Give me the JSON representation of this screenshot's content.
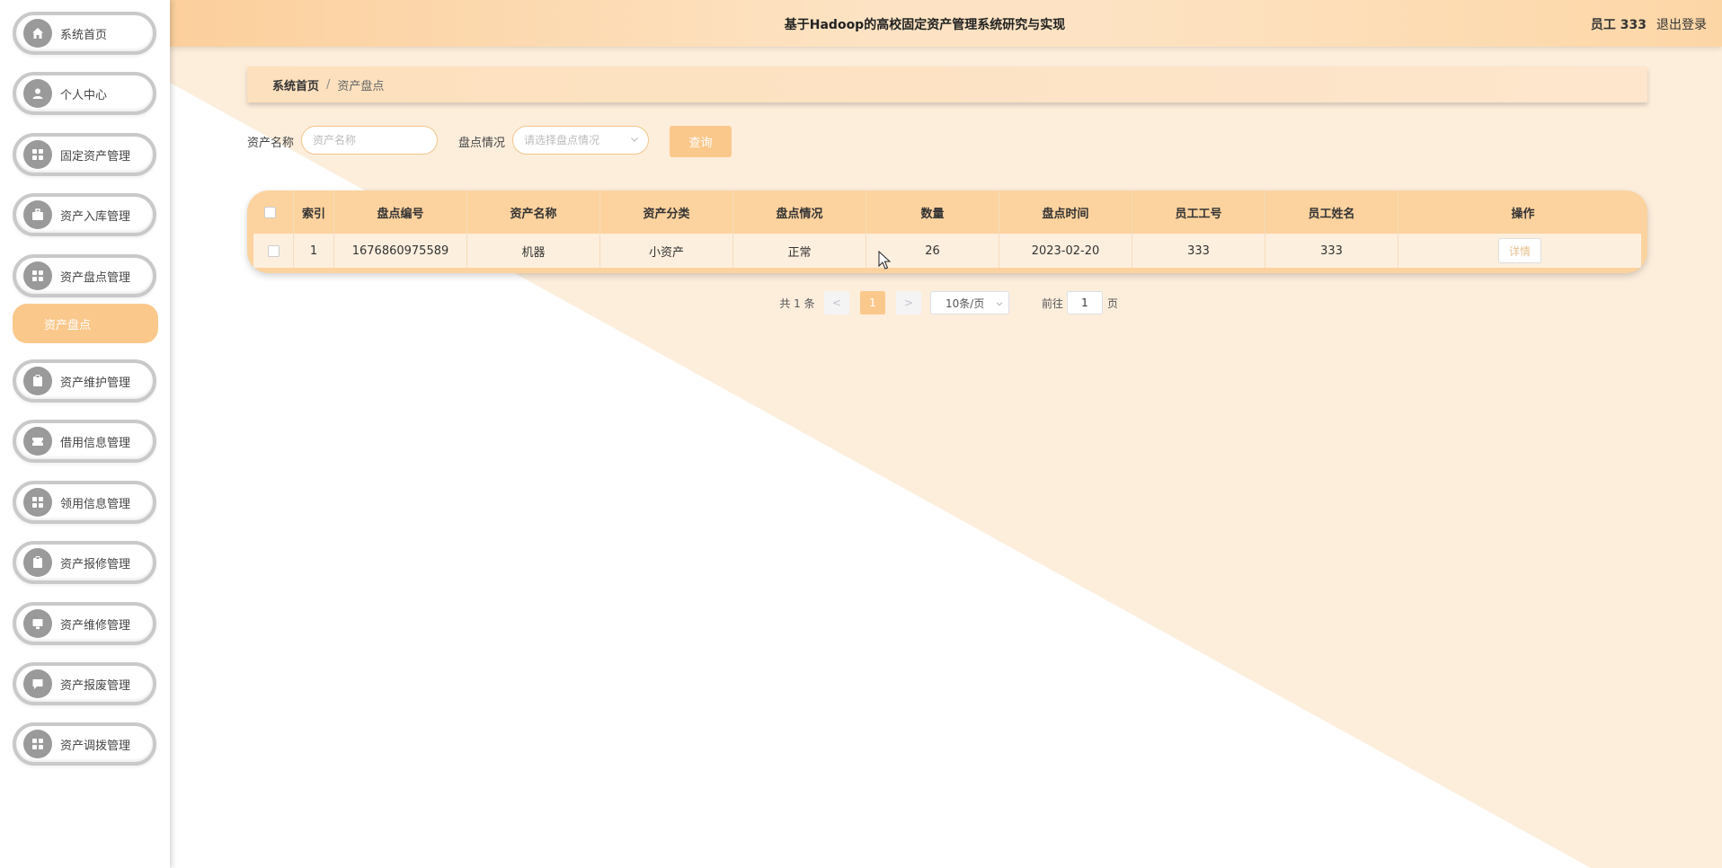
{
  "header": {
    "title": "基于Hadoop的高校固定资产管理系统研究与实现",
    "user": "员工 333",
    "logout": "退出登录"
  },
  "sidebar": {
    "items": [
      {
        "label": "系统首页",
        "icon": "home-icon"
      },
      {
        "label": "个人中心",
        "icon": "user-icon"
      },
      {
        "label": "固定资产管理",
        "icon": "grid-icon"
      },
      {
        "label": "资产入库管理",
        "icon": "briefcase-icon"
      },
      {
        "label": "资产盘点管理",
        "icon": "grid-icon"
      },
      {
        "label": "资产维护管理",
        "icon": "clipboard-icon"
      },
      {
        "label": "借用信息管理",
        "icon": "ticket-icon"
      },
      {
        "label": "领用信息管理",
        "icon": "grid-icon"
      },
      {
        "label": "资产报修管理",
        "icon": "clipboard-icon"
      },
      {
        "label": "资产维修管理",
        "icon": "monitor-icon"
      },
      {
        "label": "资产报废管理",
        "icon": "chat-icon"
      },
      {
        "label": "资产调拨管理",
        "icon": "grid-icon"
      }
    ],
    "active_submenu": "资产盘点"
  },
  "breadcrumb": {
    "home": "系统首页",
    "separator": "/",
    "current": "资产盘点"
  },
  "search": {
    "name_label": "资产名称",
    "name_placeholder": "资产名称",
    "status_label": "盘点情况",
    "status_placeholder": "请选择盘点情况",
    "query_button": "查询"
  },
  "table": {
    "columns": [
      "索引",
      "盘点编号",
      "资产名称",
      "资产分类",
      "盘点情况",
      "数量",
      "盘点时间",
      "员工工号",
      "员工姓名",
      "操作"
    ],
    "rows": [
      [
        "1",
        "1676860975589",
        "机器",
        "小资产",
        "正常",
        "26",
        "2023-02-20",
        "333",
        "333"
      ]
    ],
    "detail_button": "详情"
  },
  "pagination": {
    "total": "共 1 条",
    "prev": "<",
    "current_page": "1",
    "next": ">",
    "page_size": "10条/页",
    "goto_label": "前往",
    "goto_value": "1",
    "page_unit": "页"
  },
  "colors": {
    "accent": "#fbc88c",
    "header_bg": "#fde3c3",
    "table_header": "#fcd29e",
    "row_bg": "#fdefde",
    "background_triangle": "#fdeedc"
  }
}
